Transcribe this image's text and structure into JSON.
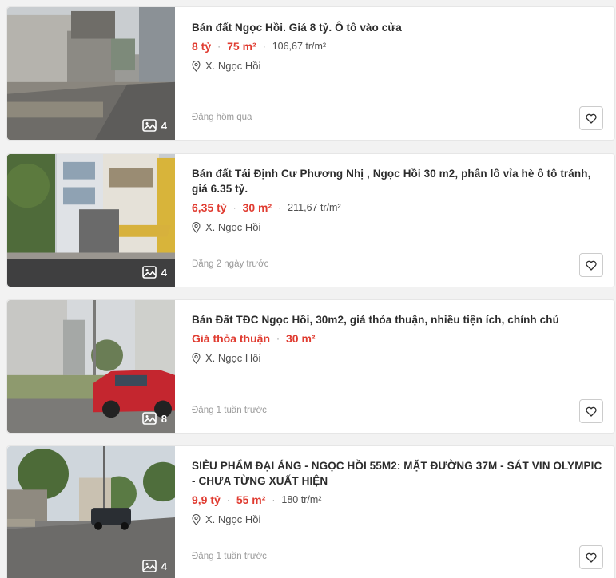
{
  "listings": [
    {
      "title": "Bán đất Ngọc Hồi. Giá 8 tỷ. Ô tô vào cửa",
      "price": "8 tỷ",
      "area": "75 m²",
      "price_per_m2": "106,67 tr/m²",
      "location": "X. Ngọc Hồi",
      "posted": "Đăng hôm qua",
      "photo_count": "4"
    },
    {
      "title": "Bán đất Tái Định Cư Phương Nhị , Ngọc Hồi 30 m2, phân lô vỉa hè ô tô tránh, giá 6.35 tỷ.",
      "price": "6,35 tỷ",
      "area": "30 m²",
      "price_per_m2": "211,67 tr/m²",
      "location": "X. Ngọc Hồi",
      "posted": "Đăng 2 ngày trước",
      "photo_count": "4"
    },
    {
      "title": "Bán Đất TĐC Ngọc Hồi, 30m2, giá thỏa thuận, nhiều tiện ích, chính chủ",
      "price": "Giá thỏa thuận",
      "area": "30 m²",
      "price_per_m2": "",
      "location": "X. Ngọc Hồi",
      "posted": "Đăng 1 tuần trước",
      "photo_count": "8"
    },
    {
      "title": "SIÊU PHẨM ĐẠI ÁNG - NGỌC HỒI 55M2: MẶT ĐƯỜNG 37M - SÁT VIN OLYMPIC - CHƯA TỪNG XUẤT HIỆN",
      "price": "9,9 tỷ",
      "area": "55 m²",
      "price_per_m2": "180 tr/m²",
      "location": "X. Ngọc Hồi",
      "posted": "Đăng 1 tuần trước",
      "photo_count": "4"
    }
  ],
  "icons": {
    "photo": "image-icon",
    "location": "map-pin-icon",
    "save": "heart-icon"
  },
  "colors": {
    "price": "#e03c31",
    "muted": "#999999",
    "title": "#2c2c2c"
  }
}
